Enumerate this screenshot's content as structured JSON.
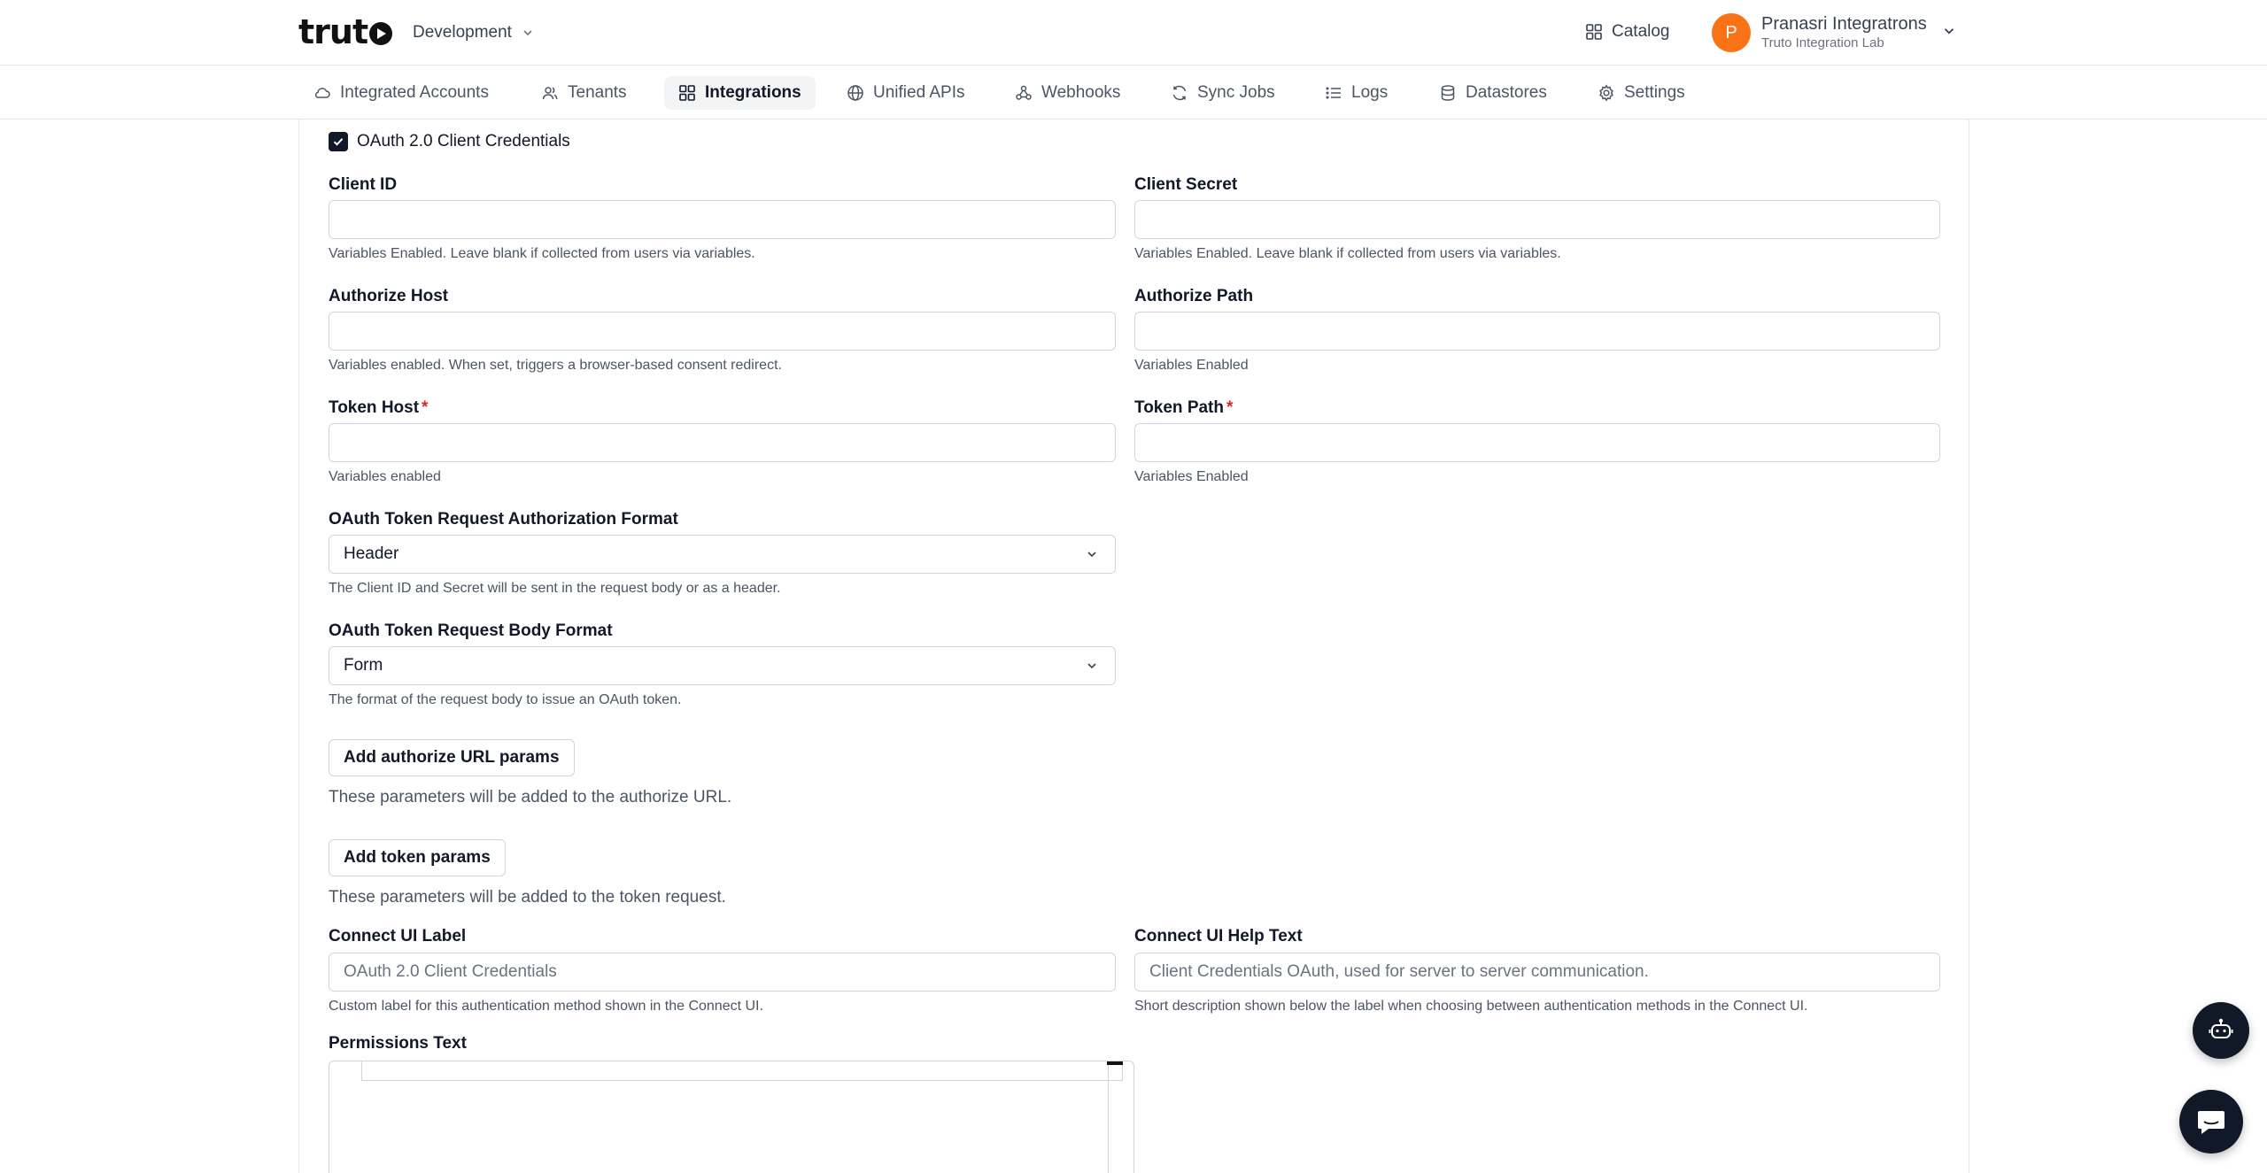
{
  "header": {
    "logo_text": "truto",
    "environment": "Development",
    "catalog_label": "Catalog",
    "user": {
      "initial": "P",
      "name": "Pranasri Integratrons",
      "org": "Truto Integration Lab"
    }
  },
  "nav": {
    "items": [
      {
        "label": "Integrated Accounts",
        "icon": "cloud-icon",
        "active": false
      },
      {
        "label": "Tenants",
        "icon": "users-icon",
        "active": false
      },
      {
        "label": "Integrations",
        "icon": "grid-icon",
        "active": true
      },
      {
        "label": "Unified APIs",
        "icon": "globe-icon",
        "active": false
      },
      {
        "label": "Webhooks",
        "icon": "webhook-icon",
        "active": false
      },
      {
        "label": "Sync Jobs",
        "icon": "sync-icon",
        "active": false
      },
      {
        "label": "Logs",
        "icon": "list-icon",
        "active": false
      },
      {
        "label": "Datastores",
        "icon": "database-icon",
        "active": false
      },
      {
        "label": "Settings",
        "icon": "gear-icon",
        "active": false
      }
    ]
  },
  "form": {
    "method_checkbox": {
      "label": "OAuth 2.0 Client Credentials",
      "checked": true
    },
    "client_id": {
      "label": "Client ID",
      "value": "",
      "help": "Variables Enabled. Leave blank if collected from users via variables."
    },
    "client_secret": {
      "label": "Client Secret",
      "value": "",
      "help": "Variables Enabled. Leave blank if collected from users via variables."
    },
    "authorize_host": {
      "label": "Authorize Host",
      "value": "",
      "help": "Variables enabled. When set, triggers a browser-based consent redirect."
    },
    "authorize_path": {
      "label": "Authorize Path",
      "value": "",
      "help": "Variables Enabled"
    },
    "token_host": {
      "label": "Token Host",
      "required_mark": "*",
      "value": "",
      "help": "Variables enabled"
    },
    "token_path": {
      "label": "Token Path",
      "required_mark": "*",
      "value": "",
      "help": "Variables Enabled"
    },
    "auth_format": {
      "label": "OAuth Token Request Authorization Format",
      "value": "Header",
      "help": "The Client ID and Secret will be sent in the request body or as a header."
    },
    "body_format": {
      "label": "OAuth Token Request Body Format",
      "value": "Form",
      "help": "The format of the request body to issue an OAuth token."
    },
    "authorize_params": {
      "button": "Add authorize URL params",
      "help": "These parameters will be added to the authorize URL."
    },
    "token_params": {
      "button": "Add token params",
      "help": "These parameters will be added to the token request."
    },
    "connect_ui_label": {
      "label": "Connect UI Label",
      "placeholder": "OAuth 2.0 Client Credentials",
      "help": "Custom label for this authentication method shown in the Connect UI."
    },
    "connect_ui_help": {
      "label": "Connect UI Help Text",
      "placeholder": "Client Credentials OAuth, used for server to server communication.",
      "help": "Short description shown below the label when choosing between authentication methods in the Connect UI."
    },
    "permissions_text": {
      "label": "Permissions Text"
    }
  },
  "colors": {
    "accent": "#111827",
    "avatar": "#f97316",
    "required": "#dc2626",
    "border": "#d1d5db"
  }
}
